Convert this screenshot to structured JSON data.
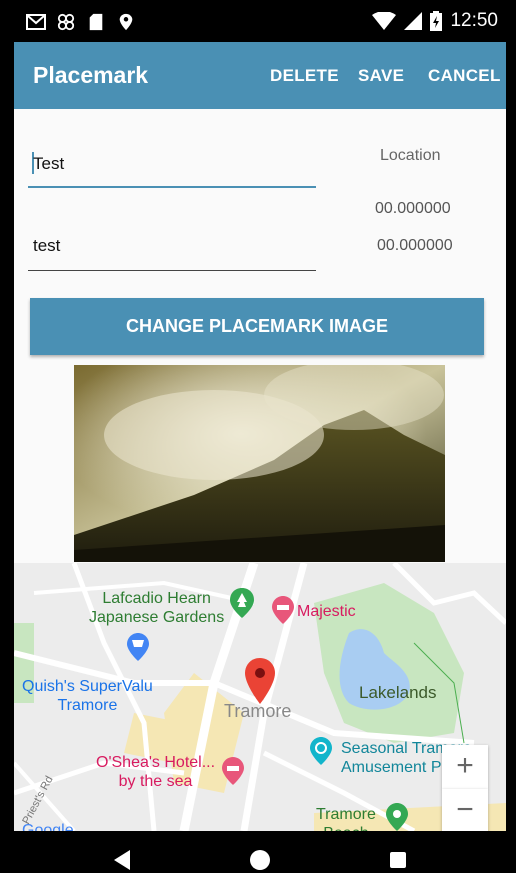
{
  "status_bar": {
    "time": "12:50",
    "icons": [
      "gmail-icon",
      "app-icon",
      "sd-card-icon",
      "location-icon",
      "wifi-icon",
      "signal-icon",
      "battery-icon"
    ]
  },
  "app_bar": {
    "title": "Placemark",
    "delete_label": "DELETE",
    "save_label": "SAVE",
    "cancel_label": "CANCEL",
    "color": "#4a90b4"
  },
  "form": {
    "title_value": "Test",
    "description_value": "test",
    "location_label": "Location",
    "latitude": "00.000000",
    "longitude": "00.000000",
    "change_image_label": "CHANGE PLACEMARK IMAGE"
  },
  "map": {
    "town_label": "Tramore",
    "pois": {
      "lafcadio": "Lafcadio Hearn\nJapanese Gardens",
      "majestic": "Majestic",
      "quish": "Quish's SuperValu\nTramore",
      "lakelands": "Lakelands",
      "oshea": "O'Shea's Hotel...\nby the sea",
      "seasonal": "Seasonal Tramore\nAmusement Park",
      "tramore_beach": "Tramore\nBeach",
      "priests_rd": "Priest's Rd"
    },
    "zoom_in": "+",
    "zoom_out": "−",
    "google": "Google"
  }
}
